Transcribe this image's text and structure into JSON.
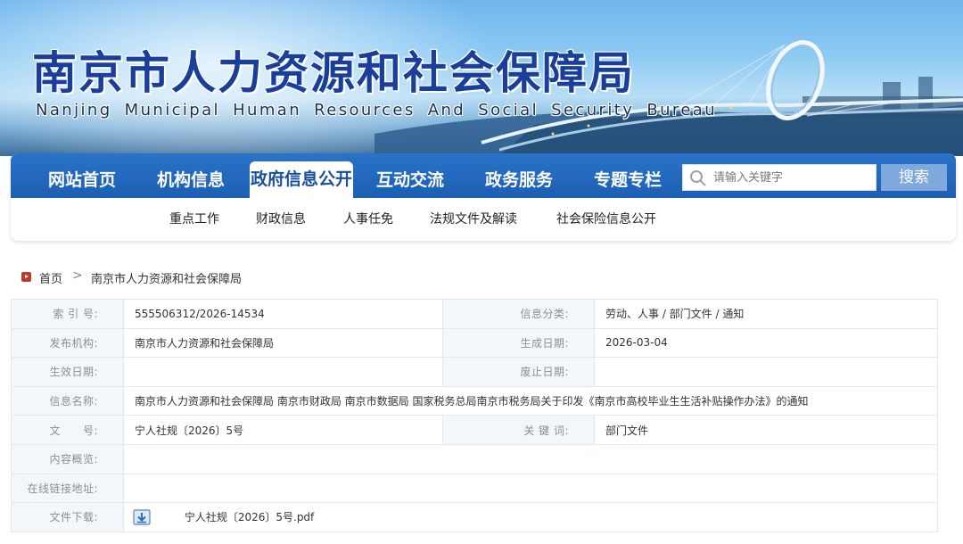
{
  "banner": {
    "title": "南京市人力资源和社会保障局",
    "subtitle": "Nanjing Municipal Human Resources And Social Security Bureau"
  },
  "nav": {
    "items": [
      {
        "label": "网站首页"
      },
      {
        "label": "机构信息"
      },
      {
        "label": "政府信息公开",
        "active": true
      },
      {
        "label": "互动交流"
      },
      {
        "label": "政务服务"
      },
      {
        "label": "专题专栏"
      }
    ],
    "search_placeholder": "请输入关键字",
    "search_button": "搜索",
    "sub_items": [
      {
        "label": "重点工作"
      },
      {
        "label": "财政信息"
      },
      {
        "label": "人事任免"
      },
      {
        "label": "法规文件及解读"
      },
      {
        "label": "社会保险信息公开"
      }
    ]
  },
  "breadcrumb": {
    "home": "首页",
    "separator": ">",
    "current": "南京市人力资源和社会保障局"
  },
  "info": {
    "index_label": "索 引 号:",
    "index_value": "555506312/2026-14534",
    "category_label": "信息分类:",
    "category_value": "劳动、人事 / 部门文件 / 通知",
    "publisher_label": "发布机构:",
    "publisher_value": "南京市人力资源和社会保障局",
    "created_label": "生成日期:",
    "created_value": "2026-03-04",
    "effective_label": "生效日期:",
    "effective_value": "",
    "expired_label": "废止日期:",
    "expired_value": "",
    "name_label": "信息名称:",
    "name_value": "南京市人力资源和社会保障局 南京市财政局 南京市数据局 国家税务总局南京市税务局关于印发《南京市高校毕业生生活补贴操作办法》的通知",
    "docno_label": "文　　号:",
    "docno_value": "宁人社规〔2026〕5号",
    "keywords_label": "关 键 词:",
    "keywords_value": "部门文件",
    "summary_label": "内容概览:",
    "summary_value": "",
    "link_label": "在线链接地址:",
    "link_value": "",
    "download_label": "文件下载:",
    "download_file": "宁人社规〔2026〕5号.pdf"
  },
  "colors": {
    "nav_blue": "#1c5fb3",
    "title_blue": "#1a3f9a",
    "search_button": "#7fa9dd",
    "label_bg": "#f3f6fa",
    "home_icon": "#c0392b"
  }
}
